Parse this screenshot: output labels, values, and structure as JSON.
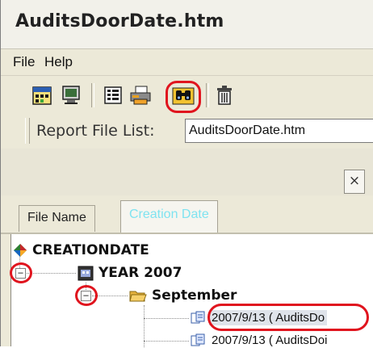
{
  "window": {
    "title": "AuditsDoorDate.htm"
  },
  "menu": {
    "file": "File",
    "help": "Help"
  },
  "toolbar": {
    "buttons": [
      "calendar-icon",
      "monitor-icon",
      "list-icon",
      "print-icon",
      "binoculars-icon",
      "delete-icon"
    ],
    "highlighted": "binoculars-icon",
    "highlight_color": "#e0141e"
  },
  "pathbar": {
    "label": "Report File List:",
    "value": "AuditsDoorDate.htm"
  },
  "panel": {
    "close_label": "×"
  },
  "tabs": [
    {
      "label": "File Name",
      "active": false
    },
    {
      "label": "Creation Date",
      "active": true
    }
  ],
  "tree": {
    "root": "CREATIONDATE",
    "year": "YEAR 2007",
    "month": "September",
    "files": [
      "2007/9/13 ( AuditsDo",
      "2007/9/13 ( AuditsDoi"
    ]
  }
}
